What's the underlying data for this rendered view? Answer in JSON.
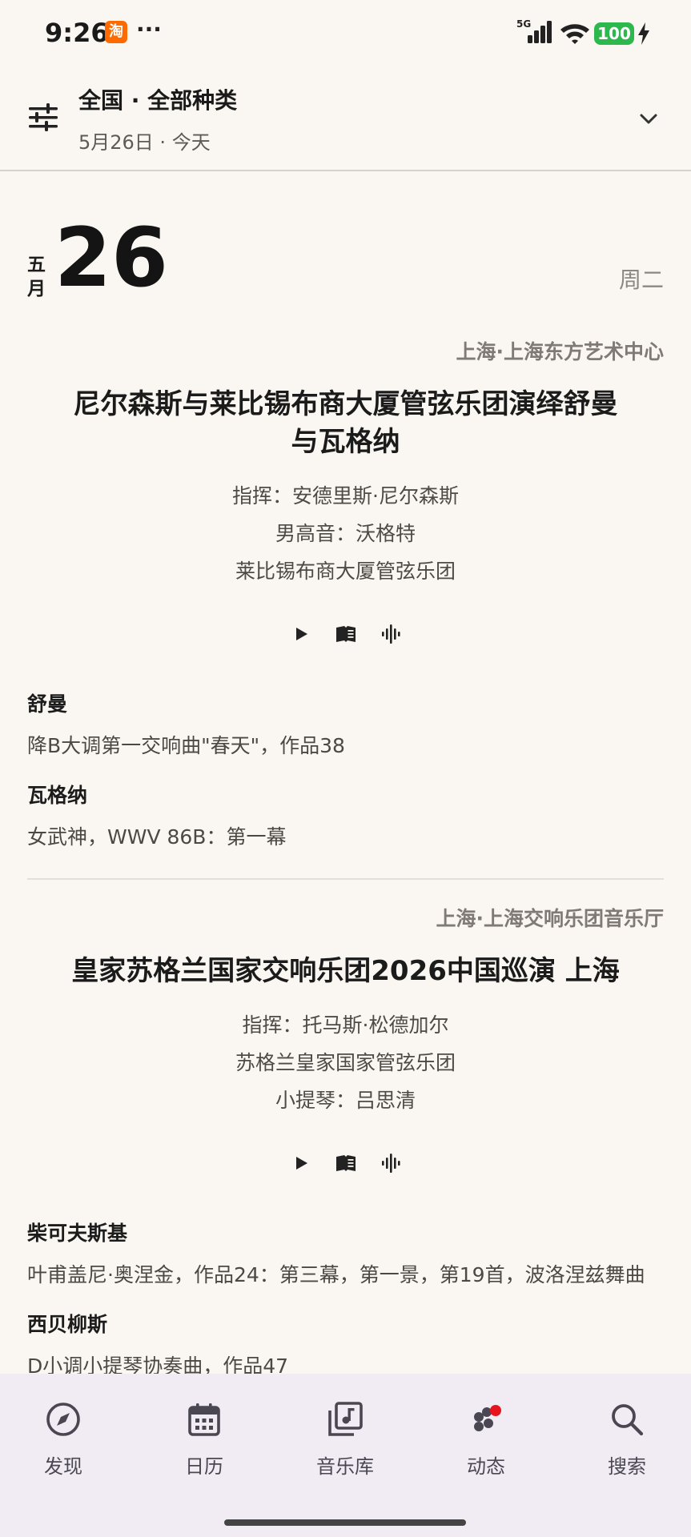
{
  "status_bar": {
    "time": "9:26",
    "app_icon_text": "淘",
    "more": "···",
    "network": "5G",
    "battery": "100"
  },
  "header": {
    "title": "全国 · 全部种类",
    "subtitle": "5月26日 · 今天"
  },
  "date": {
    "month": "五月",
    "day": "26",
    "weekday": "周二"
  },
  "events": [
    {
      "venue": "上海·上海东方艺术中心",
      "title_line1": "尼尔森斯与莱比锡布商大厦管弦乐团演绎舒曼",
      "title_line2": "与瓦格纳",
      "performers": [
        "指挥：安德里斯·尼尔森斯",
        "男高音：沃格特",
        "莱比锡布商大厦管弦乐团"
      ],
      "program": [
        {
          "composer": "舒曼",
          "work": "降B大调第一交响曲\"春天\"，作品38"
        },
        {
          "composer": "瓦格纳",
          "work": "女武神，WWV 86B：第一幕"
        }
      ]
    },
    {
      "venue": "上海·上海交响乐团音乐厅",
      "title_line1": "皇家苏格兰国家交响乐团2026中国巡演 上海",
      "title_line2": "",
      "performers": [
        "指挥：托马斯·松德加尔",
        "苏格兰皇家国家管弦乐团",
        "小提琴：吕思清"
      ],
      "program": [
        {
          "composer": "柴可夫斯基",
          "work": "叶甫盖尼·奥涅金，作品24：第三幕，第一景，第19首，波洛涅兹舞曲"
        },
        {
          "composer": "西贝柳斯",
          "work": "D小调小提琴协奏曲，作品47"
        }
      ]
    }
  ],
  "nav": {
    "items": [
      {
        "label": "发现",
        "icon": "compass-icon"
      },
      {
        "label": "日历",
        "icon": "calendar-icon"
      },
      {
        "label": "音乐库",
        "icon": "music-library-icon"
      },
      {
        "label": "动态",
        "icon": "activity-icon"
      },
      {
        "label": "搜索",
        "icon": "search-icon"
      }
    ]
  },
  "colors": {
    "background": "#faf6f1",
    "nav_background": "#f1ecf4",
    "battery_green": "#2db84d",
    "badge_red": "#e8141d"
  }
}
